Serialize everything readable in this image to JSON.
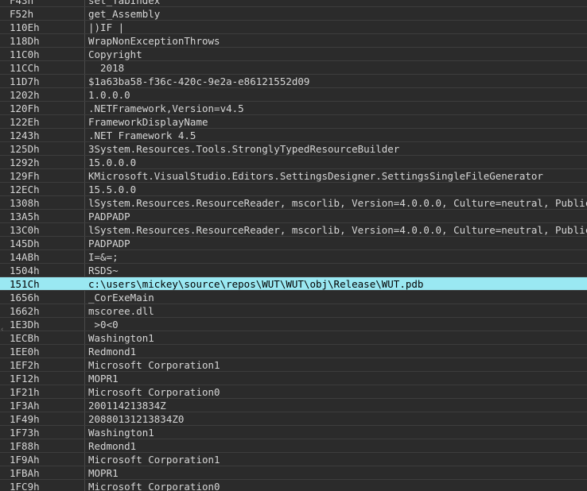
{
  "strings_table": {
    "selected_index": 21,
    "rows": [
      {
        "offset": "F43h",
        "value": "set_TabIndex"
      },
      {
        "offset": "F52h",
        "value": "get_Assembly"
      },
      {
        "offset": "110Eh",
        "value": "|)IF |"
      },
      {
        "offset": "118Dh",
        "value": "WrapNonExceptionThrows"
      },
      {
        "offset": "11C0h",
        "value": "Copyright"
      },
      {
        "offset": "11CCh",
        "value": "  2018"
      },
      {
        "offset": "11D7h",
        "value": "$1a63ba58-f36c-420c-9e2a-e86121552d09"
      },
      {
        "offset": "1202h",
        "value": "1.0.0.0"
      },
      {
        "offset": "120Fh",
        "value": ".NETFramework,Version=v4.5"
      },
      {
        "offset": "122Eh",
        "value": "FrameworkDisplayName"
      },
      {
        "offset": "1243h",
        "value": ".NET Framework 4.5"
      },
      {
        "offset": "125Dh",
        "value": "3System.Resources.Tools.StronglyTypedResourceBuilder"
      },
      {
        "offset": "1292h",
        "value": "15.0.0.0"
      },
      {
        "offset": "129Fh",
        "value": "KMicrosoft.VisualStudio.Editors.SettingsDesigner.SettingsSingleFileGenerator"
      },
      {
        "offset": "12ECh",
        "value": "15.5.0.0"
      },
      {
        "offset": "1308h",
        "value": "lSystem.Resources.ResourceReader, mscorlib, Version=4.0.0.0, Culture=neutral, PublicKeyT"
      },
      {
        "offset": "13A5h",
        "value": "PADPADP"
      },
      {
        "offset": "13C0h",
        "value": "lSystem.Resources.ResourceReader, mscorlib, Version=4.0.0.0, Culture=neutral, PublicKeyT"
      },
      {
        "offset": "145Dh",
        "value": "PADPADP"
      },
      {
        "offset": "14ABh",
        "value": "I=&=;"
      },
      {
        "offset": "1504h",
        "value": "RSDS~"
      },
      {
        "offset": "151Ch",
        "value": "c:\\users\\mickey\\source\\repos\\WUT\\WUT\\obj\\Release\\WUT.pdb"
      },
      {
        "offset": "1656h",
        "value": "_CorExeMain"
      },
      {
        "offset": "1662h",
        "value": "mscoree.dll"
      },
      {
        "offset": "1E3Dh",
        "value": " >0<0"
      },
      {
        "offset": "1ECBh",
        "value": "Washington1"
      },
      {
        "offset": "1EE0h",
        "value": "Redmond1"
      },
      {
        "offset": "1EF2h",
        "value": "Microsoft Corporation1"
      },
      {
        "offset": "1F12h",
        "value": "MOPR1"
      },
      {
        "offset": "1F21h",
        "value": "Microsoft Corporation0"
      },
      {
        "offset": "1F3Ah",
        "value": "200114213834Z"
      },
      {
        "offset": "1F49h",
        "value": "20880131213834Z0"
      },
      {
        "offset": "1F73h",
        "value": "Washington1"
      },
      {
        "offset": "1F88h",
        "value": "Redmond1"
      },
      {
        "offset": "1F9Ah",
        "value": "Microsoft Corporation1"
      },
      {
        "offset": "1FBAh",
        "value": "MOPR1"
      },
      {
        "offset": "1FC9h",
        "value": "Microsoft Corporation0"
      }
    ]
  },
  "colors": {
    "background": "#2b2b2b",
    "text": "#d6d6d6",
    "selected_row": "#9ae8f2",
    "grid_line": "#3d3d3d"
  }
}
